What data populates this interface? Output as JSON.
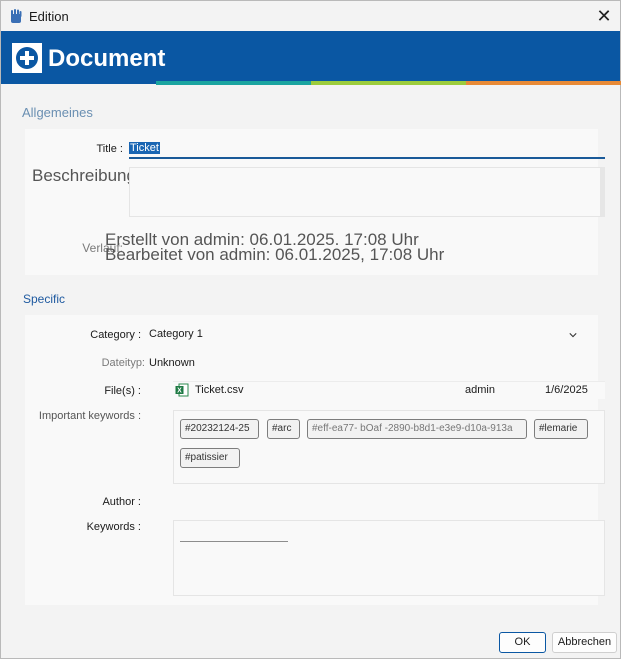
{
  "window": {
    "title": "Edition",
    "close_glyph": "✕"
  },
  "banner": {
    "heading": "Document",
    "stripe_colors": [
      "#1aa4a0",
      "#9ccc3c",
      "#e88a36"
    ],
    "accent": "#0a57a3"
  },
  "general": {
    "section_label": "Allgemeines",
    "title_label": "Title :",
    "title_value": "Ticket",
    "description_label": "Beschreibung:",
    "history_label": "Verlauf:",
    "history_created": "Erstellt von admin: 06.01.2025. 17:08 Uhr",
    "history_edited": "Bearbeitet von admin: 06.01.2025, 17:08 Uhr"
  },
  "specific": {
    "section_label": "Specific",
    "category_label": "Category :",
    "category_value": "Category 1",
    "filetype_label": "Dateityp:",
    "filetype_value": "Unknown",
    "files_label": "File(s) :",
    "file": {
      "icon": "excel-icon",
      "name": "Ticket.csv",
      "owner": "admin",
      "date": "1/6/2025"
    },
    "important_keywords_label": "Important keywords :",
    "tags": [
      "#20232124-25",
      "#arc",
      "#eff-ea77- bOaf -2890-b8d1-e3e9-d10a-913a",
      "#lemarie",
      "#patissier"
    ],
    "author_label": "Author :",
    "keywords_label": "Keywords :"
  },
  "footer": {
    "ok_label": "OK",
    "cancel_label": "Abbrechen"
  }
}
